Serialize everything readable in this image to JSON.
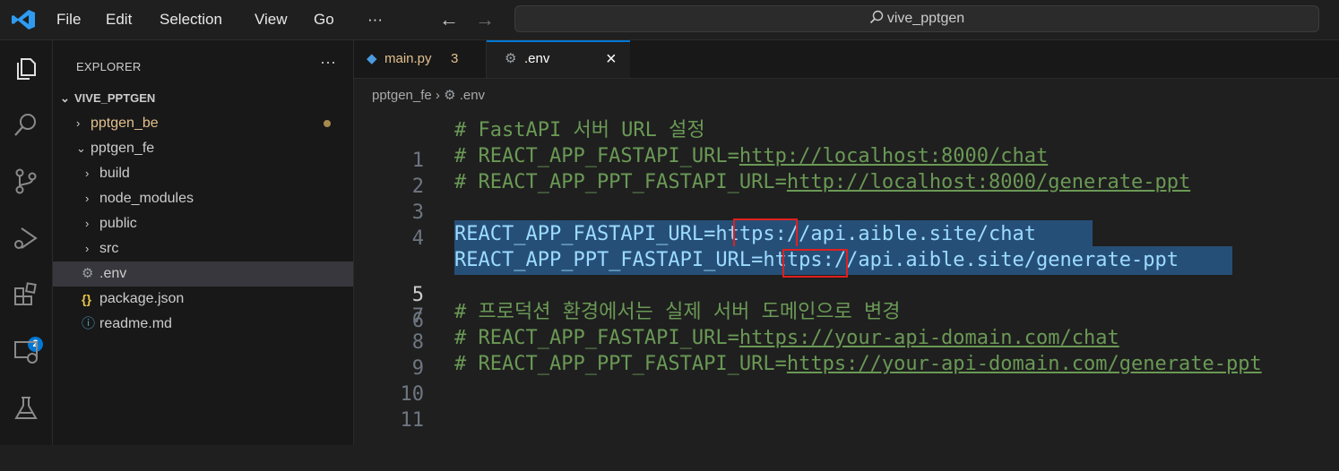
{
  "titlebar": {
    "menu": [
      "File",
      "Edit",
      "Selection",
      "View",
      "Go"
    ],
    "more": "···",
    "back": "←",
    "forward": "→",
    "search_text": "vive_pptgen"
  },
  "activity": {
    "icons": [
      "explorer-icon",
      "search-icon",
      "source-control-icon",
      "run-debug-icon",
      "extensions-icon",
      "remote-explorer-icon",
      "testing-icon"
    ],
    "extensions_badge": "2"
  },
  "sidebar": {
    "title": "EXPLORER",
    "more": "···",
    "root": "VIVE_PPTGEN",
    "items": [
      {
        "label": "pptgen_be",
        "chevron": "›"
      },
      {
        "label": "pptgen_fe",
        "chevron": "⌄"
      },
      {
        "label": "build",
        "chevron": "›"
      },
      {
        "label": "node_modules",
        "chevron": "›"
      },
      {
        "label": "public",
        "chevron": "›"
      },
      {
        "label": "src",
        "chevron": "›"
      },
      {
        "label": ".env",
        "icon": "⚙"
      },
      {
        "label": "package.json",
        "icon": "{}"
      },
      {
        "label": "readme.md",
        "icon": "ⓘ"
      }
    ]
  },
  "tabs": [
    {
      "label": "main.py",
      "count": "3"
    },
    {
      "label": ".env",
      "close": "×"
    }
  ],
  "breadcrumb": {
    "folder": "pptgen_fe",
    "sep": "›",
    "file": ".env"
  },
  "code": {
    "line_numbers": [
      "1",
      "2",
      "3",
      "4",
      "5",
      "6",
      "7",
      "8",
      "9",
      "10",
      "11"
    ],
    "l1": "# FastAPI 서버 URL 설정",
    "l2_pre": "# REACT_APP_FASTAPI_URL=",
    "l2_url": "http://localhost:8000/chat",
    "l3_pre": "# REACT_APP_PPT_FASTAPI_URL=",
    "l3_url": "http://localhost:8000/generate-ppt",
    "l5": "REACT_APP_FASTAPI_URL=https://api.aible.site/chat",
    "l6": "REACT_APP_PPT_FASTAPI_URL=https://api.aible.site/generate-ppt",
    "l8": "# 프로덕션 환경에서는 실제 서버 도메인으로 변경",
    "l9_pre": "# REACT_APP_FASTAPI_URL=",
    "l9_url": "https://your-api-domain.com/chat",
    "l10_pre": "# REACT_APP_PPT_FASTAPI_URL=",
    "l10_url": "https://your-api-domain.com/generate-ppt"
  }
}
